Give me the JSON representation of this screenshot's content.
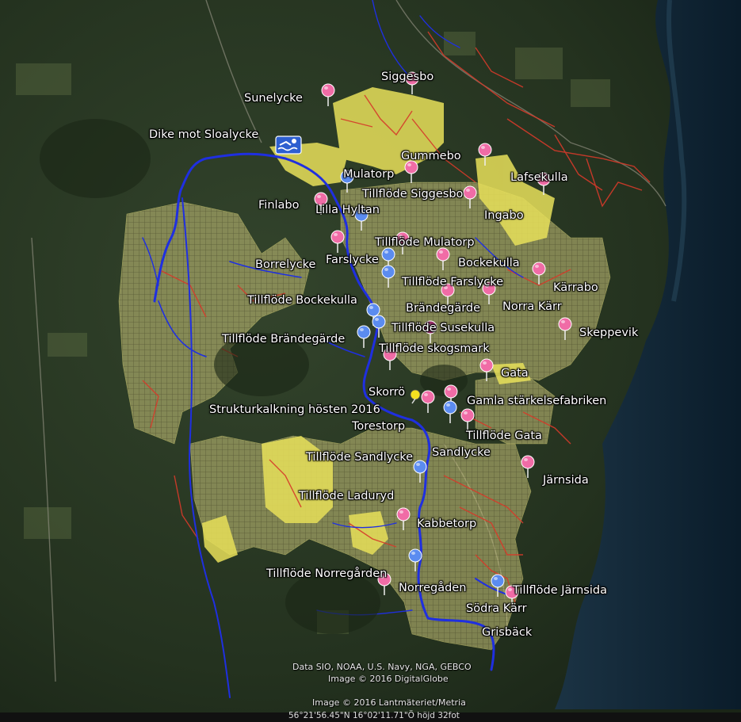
{
  "map": {
    "places": [
      {
        "id": "siggesbo",
        "label": "Siggesbo"
      },
      {
        "id": "sunelycke",
        "label": "Sunelycke"
      },
      {
        "id": "dike",
        "label": "Dike mot Sloalycke"
      },
      {
        "id": "gummebo",
        "label": "Gummebo"
      },
      {
        "id": "mulatorp",
        "label": "Mulatorp"
      },
      {
        "id": "lafsekulla",
        "label": "Lafsekulla"
      },
      {
        "id": "tf-siggesbo",
        "label": "Tillflöde Siggesbo"
      },
      {
        "id": "finlabo",
        "label": "Finlabo"
      },
      {
        "id": "lilla-hyltan",
        "label": "Lilla Hyltan"
      },
      {
        "id": "ingabo",
        "label": "Ingabo"
      },
      {
        "id": "tf-mulatorp",
        "label": "Tillflöde Mulatorp"
      },
      {
        "id": "farslycke",
        "label": "Farslycke"
      },
      {
        "id": "borrelycke",
        "label": "Borrelycke"
      },
      {
        "id": "bockekulla",
        "label": "Bockekulla"
      },
      {
        "id": "tf-farslycke",
        "label": "Tillflöde Farslycke"
      },
      {
        "id": "karrabo",
        "label": "Kärrabo"
      },
      {
        "id": "tf-bockekulla",
        "label": "Tillflöde Bockekulla"
      },
      {
        "id": "brandegarde",
        "label": "Brändegärde"
      },
      {
        "id": "norra-karr",
        "label": "Norra Kärr"
      },
      {
        "id": "tf-susekulla",
        "label": "Tillflöde Susekulla"
      },
      {
        "id": "skeppevik",
        "label": "Skeppevik"
      },
      {
        "id": "tf-brandegarde",
        "label": "Tillflöde Brändegärde"
      },
      {
        "id": "tf-skogsmark",
        "label": "Tillflöde skogsmark"
      },
      {
        "id": "gata",
        "label": "Gata"
      },
      {
        "id": "skorro",
        "label": "Skorrö"
      },
      {
        "id": "gamla",
        "label": "Gamla stärkelsefabriken"
      },
      {
        "id": "struktur",
        "label": "Strukturkalkning hösten 2016"
      },
      {
        "id": "torestorp",
        "label": "Torestorp"
      },
      {
        "id": "tf-gata",
        "label": "Tillflöde Gata"
      },
      {
        "id": "sandlycke",
        "label": "Sandlycke"
      },
      {
        "id": "tf-sandlycke",
        "label": "Tillflöde Sandlycke"
      },
      {
        "id": "jarnsida",
        "label": "Järnsida"
      },
      {
        "id": "tf-laduryd",
        "label": "Tillflöde Laduryd"
      },
      {
        "id": "kabbetorp",
        "label": "Kabbetorp"
      },
      {
        "id": "tf-norregarden",
        "label": "Tillflöde Norregården"
      },
      {
        "id": "norregaden",
        "label": "Norregåden"
      },
      {
        "id": "tf-jarnsida",
        "label": "Tillflöde Järnsida"
      },
      {
        "id": "sodra-karr",
        "label": "Södra Kärr"
      },
      {
        "id": "grisback",
        "label": "Grisbäck"
      }
    ],
    "markers": [
      {
        "color": "pink",
        "kind": "placemark-pin"
      },
      {
        "color": "blue",
        "kind": "placemark-pin"
      },
      {
        "color": "purple",
        "kind": "placemark-pin"
      },
      {
        "color": "yellow",
        "kind": "pushpin"
      },
      {
        "color": "blue",
        "kind": "water-icon"
      }
    ],
    "colors": {
      "pin_pink": "#f06ca6",
      "pin_blue": "#5b8cf0",
      "pin_purple": "#9b2f6a",
      "stream": "#1f2fe0",
      "ditch_red": "#d63a2a",
      "field_yellow": "#e8e05a",
      "sea": "#0b1e2b"
    }
  },
  "attribution": {
    "line1": "Data SIO, NOAA, U.S. Navy, NGA, GEBCO",
    "line2": "Image © 2016 DigitalGlobe",
    "line3": "Image © 2016 Lantmäteriet/Metria"
  },
  "status_bar": {
    "coords": "56°21'56.45\"N 16°02'11.71\"Ö  höjd   32fot"
  }
}
